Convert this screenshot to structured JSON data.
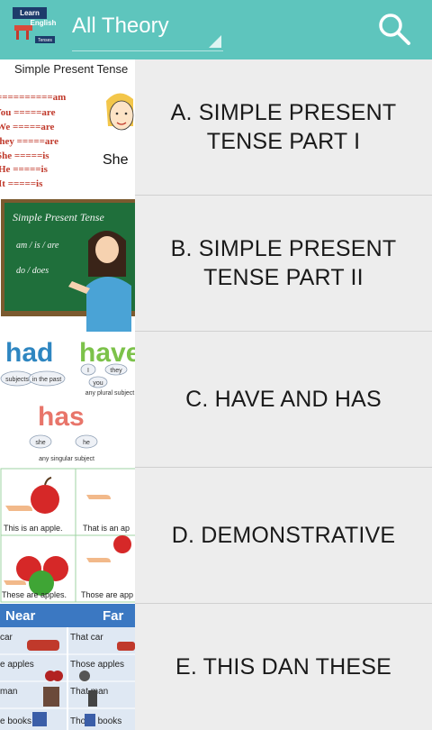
{
  "app_bar": {
    "logo_text_1": "Learn",
    "logo_text_2": "English",
    "logo_text_3": "Tenses",
    "spinner_selected": "All Theory"
  },
  "lessons": [
    {
      "label": "A. SIMPLE PRESENT TENSE PART I",
      "thumb": {
        "title": "Simple Present Tense",
        "rows": [
          "==========am",
          "You =====are",
          "We =====are",
          "They =====are",
          "She =====is",
          "He =====is",
          "It =====is"
        ],
        "caption": "She"
      }
    },
    {
      "label": "B. SIMPLE PRESENT TENSE PART II",
      "thumb": {
        "title": "Simple Present Tense",
        "line1": "am / is / are",
        "line2": "do / does"
      }
    },
    {
      "label": "C. HAVE AND HAS",
      "thumb": {
        "w_had": "had",
        "w_have": "have",
        "w_has": "has",
        "c_subjects": "subjects",
        "c_past": "in the past",
        "c_i": "I",
        "c_they": "they",
        "c_you": "you",
        "c_plural": "any plural subject",
        "c_she": "she",
        "c_he": "he",
        "c_singular": "any singular subject"
      }
    },
    {
      "label": "D. DEMONSTRATIVE",
      "thumb": {
        "cap1": "This is an apple.",
        "cap2": "That is an ap",
        "cap3": "These are apples.",
        "cap4": "Those are app"
      }
    },
    {
      "label": "E. THIS DAN THESE",
      "thumb": {
        "near": "Near",
        "far": "Far",
        "rows": [
          [
            "car",
            "That car"
          ],
          [
            "e apples",
            "Those apples"
          ],
          [
            "man",
            "That man"
          ],
          [
            "e books",
            "Those books"
          ]
        ]
      }
    }
  ]
}
